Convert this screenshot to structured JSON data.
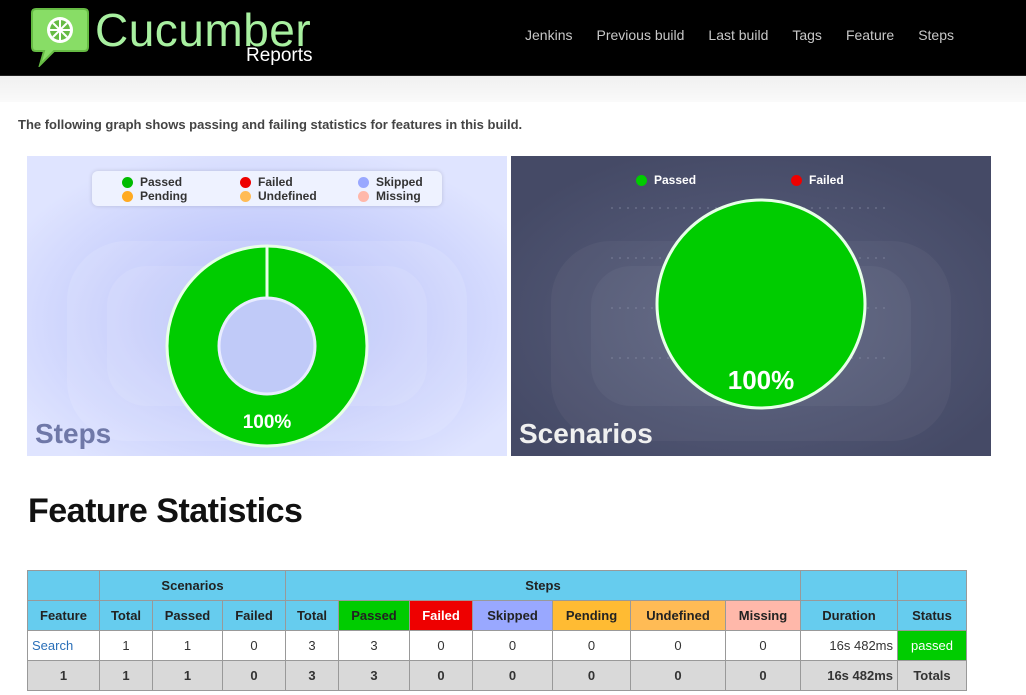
{
  "header": {
    "logo_title": "Cucumber",
    "logo_subtitle": "Reports",
    "nav": [
      "Jenkins",
      "Previous build",
      "Last build",
      "Tags",
      "Feature",
      "Steps"
    ]
  },
  "intro_text": "The following graph shows passing and failing statistics for features in this build.",
  "colors": {
    "passed": "#00cc00",
    "failed": "#ee0000",
    "skipped": "#99a8ff",
    "pending": "#ffbb33",
    "undefined": "#ffbb55",
    "missing": "#ffb8aa",
    "header_bg": "#66ccee"
  },
  "chart_data": [
    {
      "type": "pie",
      "title": "Steps",
      "legend": [
        "Passed",
        "Failed",
        "Skipped",
        "Pending",
        "Undefined",
        "Missing"
      ],
      "values": [
        3,
        0,
        0,
        0,
        0,
        0
      ],
      "label": "100%"
    },
    {
      "type": "pie",
      "title": "Scenarios",
      "legend": [
        "Passed",
        "Failed"
      ],
      "values": [
        1,
        0
      ],
      "label": "100%"
    }
  ],
  "feature_stats": {
    "title": "Feature Statistics",
    "group_headers": {
      "scenarios": "Scenarios",
      "steps": "Steps"
    },
    "columns": [
      "Feature",
      "Total",
      "Passed",
      "Failed",
      "Total",
      "Passed",
      "Failed",
      "Skipped",
      "Pending",
      "Undefined",
      "Missing",
      "Duration",
      "Status"
    ],
    "row": {
      "feature": "Search",
      "scen_total": "1",
      "scen_passed": "1",
      "scen_failed": "0",
      "steps_total": "3",
      "steps_passed": "3",
      "steps_failed": "0",
      "steps_skipped": "0",
      "steps_pending": "0",
      "steps_undefined": "0",
      "steps_missing": "0",
      "duration": "16s 482ms",
      "status": "passed"
    },
    "totals": {
      "feature": "1",
      "scen_total": "1",
      "scen_passed": "1",
      "scen_failed": "0",
      "steps_total": "3",
      "steps_passed": "3",
      "steps_failed": "0",
      "steps_skipped": "0",
      "steps_pending": "0",
      "steps_undefined": "0",
      "steps_missing": "0",
      "duration": "16s 482ms",
      "status": "Totals"
    }
  }
}
